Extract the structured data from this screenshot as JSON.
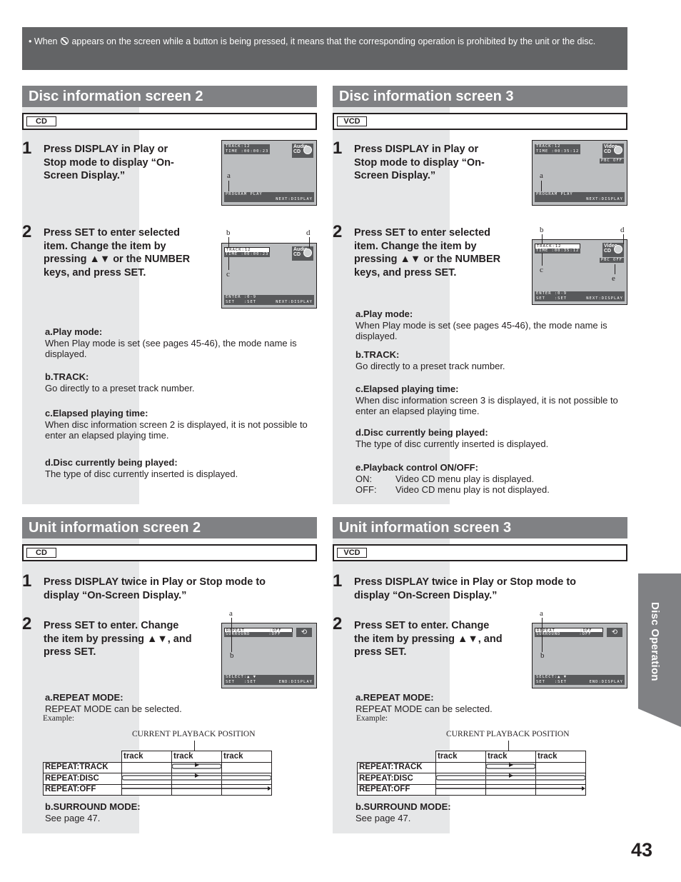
{
  "notice": {
    "before_icon": "• When ",
    "icon": "prohibited-icon",
    "after_icon": " appears on the screen while a button is being pressed, it means that the corresponding operation is prohibited by the unit or the disc."
  },
  "sections": [
    {
      "title": "Disc information screen 2",
      "disc_type": "CD",
      "steps": [
        {
          "num": "1",
          "text": "Press DISPLAY in Play or Stop mode to display “On-Screen Display.”"
        },
        {
          "num": "2",
          "text": "Press SET to enter selected item. Change the item by pressing ▲▼ or the NUMBER keys, and press SET."
        }
      ],
      "osd1": {
        "track": "TRACK:12",
        "time": "TIME :00:00:23",
        "logo_top": "Audio",
        "logo_bottom": "CD",
        "mode": "PROGRAM PLAY",
        "hint": "NEXT:DISPLAY",
        "label_a": "a"
      },
      "osd2": {
        "track": "TRACK:12",
        "time": "TIME :00:00:23",
        "logo_top": "Audio",
        "logo_bottom": "CD",
        "enter": "ENTER :0-9",
        "set": "SET   :SET",
        "hint": "NEXT:DISPLAY",
        "label_b": "b",
        "label_c": "c",
        "label_d": "d"
      },
      "descriptions": [
        {
          "heading": "a.Play mode:",
          "body": "When Play mode is set (see pages 45-46), the mode name is displayed."
        },
        {
          "heading": "b.TRACK:",
          "body": "Go directly to a preset track number."
        },
        {
          "heading": "c.Elapsed playing time:",
          "body": "When disc information screen 2 is displayed, it is not possible to enter an elapsed playing time."
        },
        {
          "heading": "d.Disc currently being played:",
          "body": "The type of disc currently inserted is displayed."
        }
      ]
    },
    {
      "title": "Disc information screen 3",
      "disc_type": "VCD",
      "steps": [
        {
          "num": "1",
          "text": "Press DISPLAY in Play or Stop mode to display “On-Screen Display.”"
        },
        {
          "num": "2",
          "text": "Press SET to enter selected item. Change the item by pressing ▲▼ or the NUMBER keys, and press SET."
        }
      ],
      "osd1": {
        "track": "TRACK:12",
        "time": "TIME :00:35:12",
        "logo_top": "Video",
        "logo_bottom": "CD",
        "pbc": "PBC OFF",
        "mode": "PROGRAM PLAY",
        "hint": "NEXT:DISPLAY",
        "label_a": "a"
      },
      "osd2": {
        "track": "TRACK:12",
        "time": "TIME :00:35:12",
        "logo_top": "Video",
        "logo_bottom": "CD",
        "pbc": "PBC OFF",
        "enter": "ENTER :0-9",
        "set": "SET   :SET",
        "hint": "NEXT:DISPLAY",
        "label_b": "b",
        "label_c": "c",
        "label_d": "d",
        "label_e": "e"
      },
      "descriptions": [
        {
          "heading": "a.Play mode:",
          "body": "When Play mode is set (see pages 45-46), the mode name is displayed."
        },
        {
          "heading": "b.TRACK:",
          "body": "Go directly to a preset track number."
        },
        {
          "heading": "c.Elapsed playing time:",
          "body": "When disc information screen 3 is displayed, it is not possible to enter an elapsed playing time."
        },
        {
          "heading": "d.Disc currently being played:",
          "body": "The type of disc currently inserted is displayed."
        },
        {
          "heading": "e.Playback control ON/OFF:",
          "rows": [
            {
              "key": "ON:",
              "value": "Video CD menu play is displayed."
            },
            {
              "key": "OFF:",
              "value": "Video CD menu play is not displayed."
            }
          ]
        }
      ]
    },
    {
      "title": "Unit information screen 2",
      "disc_type": "CD",
      "steps": [
        {
          "num": "1",
          "text": "Press DISPLAY twice in Play or Stop mode  to display “On-Screen Display.”"
        },
        {
          "num": "2",
          "text": "Press SET to enter. Change the item by pressing ▲▼, and press SET."
        }
      ],
      "osd": {
        "repeat": "REPEAT        :OFF",
        "surround": "SURROUND      :OFF",
        "select": "SELECT:▲ ▼",
        "set": "SET   :SET",
        "hint": "END:DISPLAY",
        "label_a": "a",
        "label_b": "b"
      },
      "repeat_mode": {
        "heading": "a.REPEAT MODE:",
        "body": "REPEAT MODE can be selected.",
        "example": "Example:"
      },
      "surround_mode": {
        "heading": "b.SURROUND MODE:",
        "body": "See page 47."
      }
    },
    {
      "title": "Unit information screen 3",
      "disc_type": "VCD",
      "steps": [
        {
          "num": "1",
          "text": "Press DISPLAY twice in Play or Stop mode  to display “On-Screen Display.”"
        },
        {
          "num": "2",
          "text": "Press SET to enter. Change the item by pressing ▲▼, and press SET."
        }
      ],
      "osd": {
        "repeat": "REPEAT        :OFF",
        "surround": "SURROUND      :OFF",
        "select": "SELECT:▲ ▼",
        "set": "SET   :SET",
        "hint": "END:DISPLAY",
        "label_a": "a",
        "label_b": "b"
      },
      "repeat_mode": {
        "heading": "a.REPEAT MODE:",
        "body": "REPEAT MODE can be selected.",
        "example": "Example:"
      },
      "surround_mode": {
        "heading": "b.SURROUND MODE:",
        "body": "See page 47."
      }
    }
  ],
  "repeat_table": {
    "caption": "CURRENT PLAYBACK POSITION",
    "columns": [
      "track",
      "track",
      "track"
    ],
    "rows": [
      "REPEAT:TRACK",
      "REPEAT:DISC",
      "REPEAT:OFF"
    ]
  },
  "side_tab": "Disc Operation",
  "page_number": "43"
}
